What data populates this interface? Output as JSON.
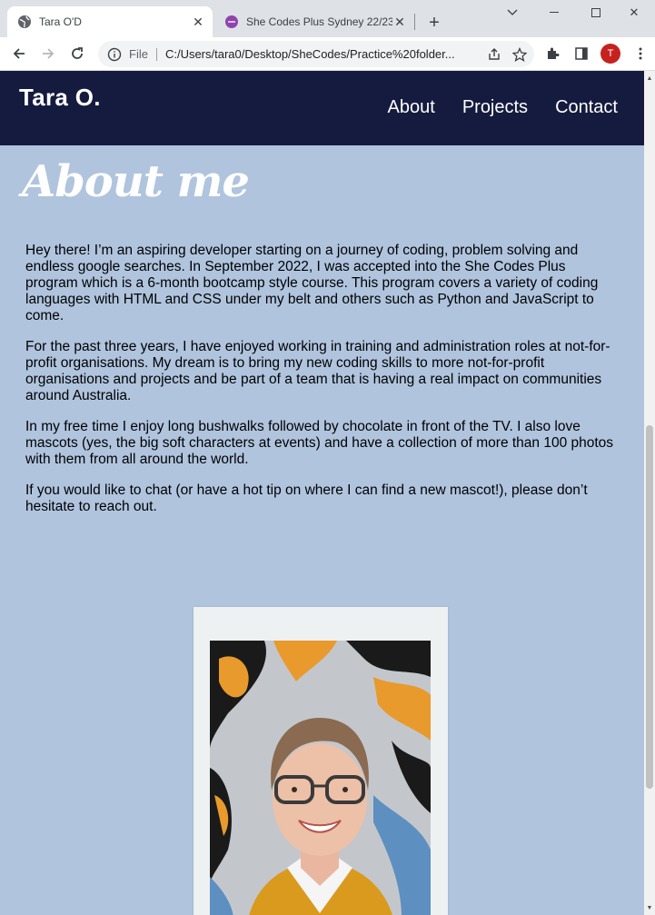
{
  "browser": {
    "tabs": [
      {
        "title": "Tara O'D",
        "active": true,
        "icon": "globe-icon"
      },
      {
        "title": "She Codes Plus Sydney 22/23",
        "active": false,
        "icon": "shecodes-icon"
      }
    ],
    "address": {
      "scheme": "File",
      "url": "C:/Users/tara0/Desktop/SheCodes/Practice%20folder..."
    },
    "profile_initial": "T",
    "colors": {
      "profile": "#c5221f",
      "page_bg": "#b0c4de",
      "header_bg": "#151b3f"
    }
  },
  "site": {
    "brand": "Tara O.",
    "nav": [
      {
        "label": "About"
      },
      {
        "label": "Projects"
      },
      {
        "label": "Contact"
      }
    ],
    "about": {
      "heading": "About me",
      "paragraphs": [
        "Hey there! I’m an aspiring developer starting on a journey of coding, problem solving and endless google searches. In September 2022, I was accepted into the She Codes Plus program which is a 6-month bootcamp style course. This program covers a variety of coding languages with HTML and CSS under my belt and others such as Python and JavaScript to come.",
        "For the past three years, I have enjoyed working in training and administration roles at not-for-profit organisations. My dream is to bring my new coding skills to more not-for-profit organisations and projects and be part of a team that is having a real impact on communities around Australia.",
        "In my free time I enjoy long bushwalks followed by chocolate in front of the TV. I also love mascots (yes, the big soft characters at events) and have a collection of more than 100 photos with them from all around the world.",
        "If you would like to chat (or have a hot tip on where I can find a new mascot!), please don’t hesitate to reach out."
      ]
    }
  }
}
